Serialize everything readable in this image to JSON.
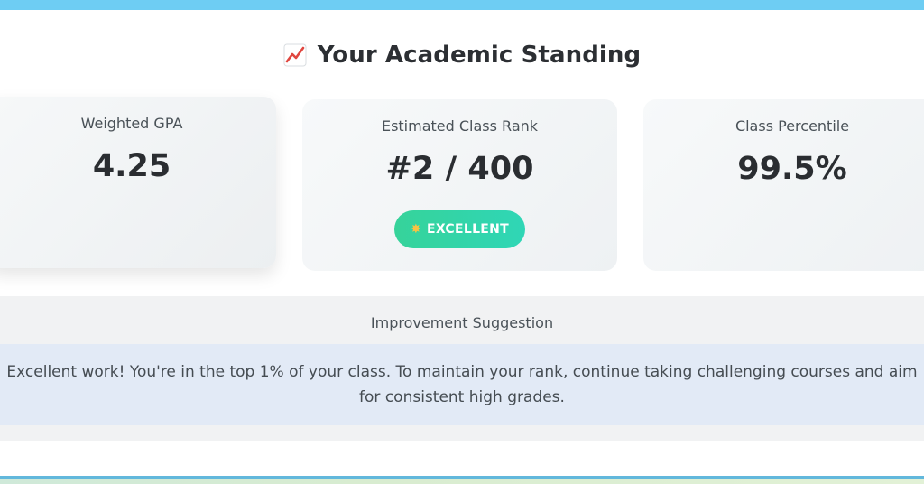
{
  "heading": {
    "icon": "chart-increasing-icon",
    "title": "Your Academic Standing"
  },
  "cards": {
    "gpa": {
      "label": "Weighted GPA",
      "value": "4.25"
    },
    "rank": {
      "label": "Estimated Class Rank",
      "value": "#2 / 400",
      "badge": "EXCELLENT",
      "badge_icon": "star-icon"
    },
    "percentile": {
      "label": "Class Percentile",
      "value": "99.5%"
    }
  },
  "suggestion": {
    "title": "Improvement Suggestion",
    "text": "Excellent work! You're in the top 1% of your class. To maintain your rank, continue taking challenging courses and aim for consistent high grades."
  },
  "colors": {
    "top_bar": "#6ecdf3",
    "badge": "#36d39a",
    "suggestion_box": "#e2eaf6"
  }
}
